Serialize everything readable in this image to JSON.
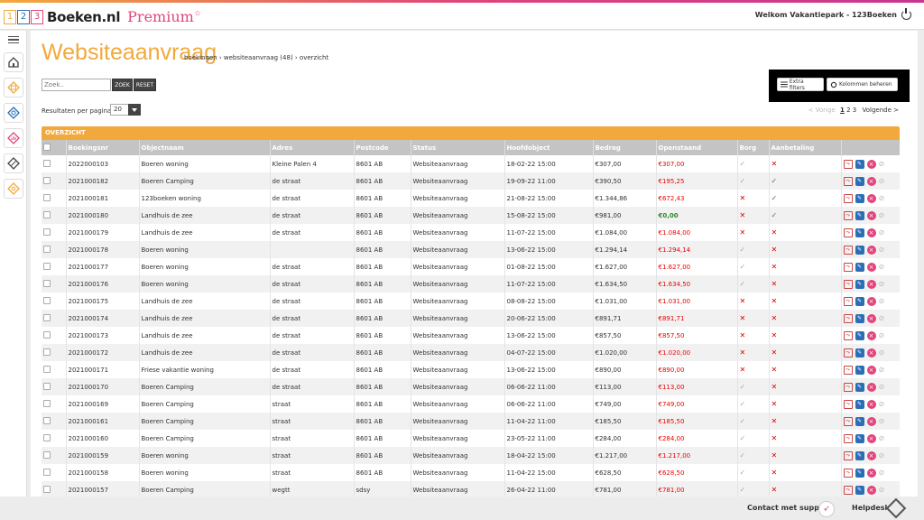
{
  "header": {
    "logo_digits": [
      "1",
      "2",
      "3"
    ],
    "logo_text": "Boeken.nl",
    "premium": "Premium",
    "star": "☆",
    "welcome": "Welkom Vakantiepark - 123Boeken",
    "power_icon": "power-icon"
  },
  "sidebar": {
    "items": [
      {
        "icon": "menu-toggle-icon"
      },
      {
        "icon": "home-icon"
      },
      {
        "icon": "calendar-icon"
      },
      {
        "icon": "objects-icon"
      },
      {
        "icon": "chart-icon"
      },
      {
        "icon": "tag-icon"
      },
      {
        "icon": "settings-icon"
      }
    ]
  },
  "page": {
    "title": "Websiteaanvraag",
    "breadcrumb": "boekingen  › websiteaanvraag (48)  › overzicht"
  },
  "search": {
    "placeholder": "Zoek..",
    "search_button": "ZOEK",
    "reset_button": "RESET"
  },
  "toolbar": {
    "extra_filters": "Extra filters",
    "manage_columns": "Kolommen beheren"
  },
  "pagination": {
    "rpp_label": "Resultaten per pagina",
    "rpp_value": "20",
    "prev": "< Vorige",
    "page1": "1",
    "page2": "2",
    "page3": "3",
    "next": "Volgende >"
  },
  "table": {
    "section_title": "OVERZICHT",
    "columns": [
      "Boekingsnr",
      "Objectnaam",
      "Adres",
      "Postcode",
      "Status",
      "Hoofdobject",
      "Bedrag",
      "Openstaand",
      "Borg",
      "Aanbetaling"
    ],
    "rows": [
      {
        "nr": "2022000103",
        "object": "Boeren woning",
        "adres": "Kleine Palen 4",
        "postcode": "8601 AB",
        "status": "Websiteaanvraag",
        "datum": "18-02-22 15:00",
        "bedrag": "€307,00",
        "open": "€307,00",
        "open_color": "red",
        "borg": "check",
        "aanbet": "x"
      },
      {
        "nr": "2021000182",
        "object": "Boeren Camping",
        "adres": "de straat",
        "postcode": "8601 AB",
        "status": "Websiteaanvraag",
        "datum": "19-09-22 11:00",
        "bedrag": "€390,50",
        "open": "€195,25",
        "open_color": "red",
        "borg": "check",
        "aanbet": "check-dark"
      },
      {
        "nr": "2021000181",
        "object": "123boeken woning",
        "adres": "de straat",
        "postcode": "8601 AB",
        "status": "Websiteaanvraag",
        "datum": "21-08-22 15:00",
        "bedrag": "€1.344,86",
        "open": "€672,43",
        "open_color": "red",
        "borg": "x",
        "aanbet": "check-dark"
      },
      {
        "nr": "2021000180",
        "object": "Landhuis de zee",
        "adres": "de straat",
        "postcode": "8601 AB",
        "status": "Websiteaanvraag",
        "datum": "15-08-22 15:00",
        "bedrag": "€981,00",
        "open": "€0,00",
        "open_color": "green",
        "borg": "x",
        "aanbet": "check-dark"
      },
      {
        "nr": "2021000179",
        "object": "Landhuis de zee",
        "adres": "de straat",
        "postcode": "8601 AB",
        "status": "Websiteaanvraag",
        "datum": "11-07-22 15:00",
        "bedrag": "€1.084,00",
        "open": "€1.084,00",
        "open_color": "red",
        "borg": "x",
        "aanbet": "x"
      },
      {
        "nr": "2021000178",
        "object": "Boeren woning",
        "adres": "",
        "postcode": "8601 AB",
        "status": "Websiteaanvraag",
        "datum": "13-06-22 15:00",
        "bedrag": "€1.294,14",
        "open": "€1.294,14",
        "open_color": "red",
        "borg": "check",
        "aanbet": "x"
      },
      {
        "nr": "2021000177",
        "object": "Boeren woning",
        "adres": "de straat",
        "postcode": "8601 AB",
        "status": "Websiteaanvraag",
        "datum": "01-08-22 15:00",
        "bedrag": "€1.627,00",
        "open": "€1.627,00",
        "open_color": "red",
        "borg": "check",
        "aanbet": "x"
      },
      {
        "nr": "2021000176",
        "object": "Boeren woning",
        "adres": "de straat",
        "postcode": "8601 AB",
        "status": "Websiteaanvraag",
        "datum": "11-07-22 15:00",
        "bedrag": "€1.634,50",
        "open": "€1.634,50",
        "open_color": "red",
        "borg": "check",
        "aanbet": "x"
      },
      {
        "nr": "2021000175",
        "object": "Landhuis de zee",
        "adres": "de straat",
        "postcode": "8601 AB",
        "status": "Websiteaanvraag",
        "datum": "08-08-22 15:00",
        "bedrag": "€1.031,00",
        "open": "€1.031,00",
        "open_color": "red",
        "borg": "x",
        "aanbet": "x"
      },
      {
        "nr": "2021000174",
        "object": "Landhuis de zee",
        "adres": "de straat",
        "postcode": "8601 AB",
        "status": "Websiteaanvraag",
        "datum": "20-06-22 15:00",
        "bedrag": "€891,71",
        "open": "€891,71",
        "open_color": "red",
        "borg": "x",
        "aanbet": "x"
      },
      {
        "nr": "2021000173",
        "object": "Landhuis de zee",
        "adres": "de straat",
        "postcode": "8601 AB",
        "status": "Websiteaanvraag",
        "datum": "13-06-22 15:00",
        "bedrag": "€857,50",
        "open": "€857,50",
        "open_color": "red",
        "borg": "x",
        "aanbet": "x"
      },
      {
        "nr": "2021000172",
        "object": "Landhuis de zee",
        "adres": "de straat",
        "postcode": "8601 AB",
        "status": "Websiteaanvraag",
        "datum": "04-07-22 15:00",
        "bedrag": "€1.020,00",
        "open": "€1.020,00",
        "open_color": "red",
        "borg": "x",
        "aanbet": "x"
      },
      {
        "nr": "2021000171",
        "object": "Friese vakantie woning",
        "adres": "de straat",
        "postcode": "8601 AB",
        "status": "Websiteaanvraag",
        "datum": "13-06-22 15:00",
        "bedrag": "€890,00",
        "open": "€890,00",
        "open_color": "red",
        "borg": "x",
        "aanbet": "x"
      },
      {
        "nr": "2021000170",
        "object": "Boeren Camping",
        "adres": "de straat",
        "postcode": "8601 AB",
        "status": "Websiteaanvraag",
        "datum": "06-06-22 11:00",
        "bedrag": "€113,00",
        "open": "€113,00",
        "open_color": "red",
        "borg": "check",
        "aanbet": "x"
      },
      {
        "nr": "2021000169",
        "object": "Boeren Camping",
        "adres": "straat",
        "postcode": "8601 AB",
        "status": "Websiteaanvraag",
        "datum": "06-06-22 11:00",
        "bedrag": "€749,00",
        "open": "€749,00",
        "open_color": "red",
        "borg": "check",
        "aanbet": "x"
      },
      {
        "nr": "2021000161",
        "object": "Boeren Camping",
        "adres": "straat",
        "postcode": "8601 AB",
        "status": "Websiteaanvraag",
        "datum": "11-04-22 11:00",
        "bedrag": "€185,50",
        "open": "€185,50",
        "open_color": "red",
        "borg": "check",
        "aanbet": "x"
      },
      {
        "nr": "2021000160",
        "object": "Boeren Camping",
        "adres": "straat",
        "postcode": "8601 AB",
        "status": "Websiteaanvraag",
        "datum": "23-05-22 11:00",
        "bedrag": "€284,00",
        "open": "€284,00",
        "open_color": "red",
        "borg": "check",
        "aanbet": "x"
      },
      {
        "nr": "2021000159",
        "object": "Boeren woning",
        "adres": "straat",
        "postcode": "8601 AB",
        "status": "Websiteaanvraag",
        "datum": "18-04-22 15:00",
        "bedrag": "€1.217,00",
        "open": "€1.217,00",
        "open_color": "red",
        "borg": "check",
        "aanbet": "x"
      },
      {
        "nr": "2021000158",
        "object": "Boeren woning",
        "adres": "straat",
        "postcode": "8601 AB",
        "status": "Websiteaanvraag",
        "datum": "11-04-22 15:00",
        "bedrag": "€628,50",
        "open": "€628,50",
        "open_color": "red",
        "borg": "check",
        "aanbet": "x"
      },
      {
        "nr": "2021000157",
        "object": "Boeren Camping",
        "adres": "wegtt",
        "postcode": "sdsy",
        "status": "Websiteaanvraag",
        "datum": "26-04-22 11:00",
        "bedrag": "€781,00",
        "open": "€781,00",
        "open_color": "red",
        "borg": "check",
        "aanbet": "x"
      }
    ]
  },
  "footer": {
    "support": "Contact met support",
    "helpdesk": "Helpdesk"
  },
  "colors": {
    "accent": "#f2a93b",
    "brand_pink": "#e0457b",
    "negative": "#ee0000",
    "positive": "#2a8a2a"
  }
}
